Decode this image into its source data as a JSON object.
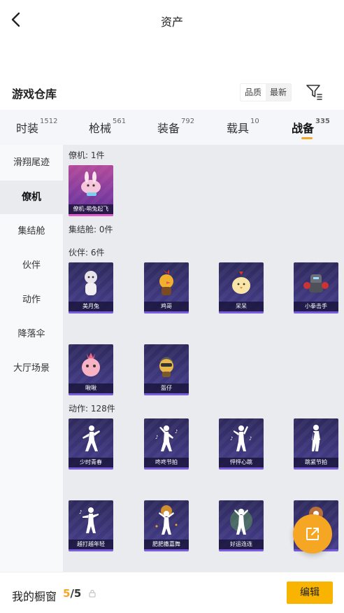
{
  "header": {
    "title": "资产",
    "back_icon": "chevron-left-icon"
  },
  "repo": {
    "title": "游戏仓库",
    "sort_options": [
      "品质",
      "最新"
    ],
    "sort_selected": "最新",
    "filter_icon": "filter-icon"
  },
  "tabs": [
    {
      "label": "时装",
      "count": "1512"
    },
    {
      "label": "枪械",
      "count": "561"
    },
    {
      "label": "装备",
      "count": "792"
    },
    {
      "label": "载具",
      "count": "10"
    },
    {
      "label": "战备",
      "count": "335",
      "active": true
    }
  ],
  "sidebar": [
    {
      "label": "滑翔尾迹"
    },
    {
      "label": "僚机",
      "active": true
    },
    {
      "label": "集结舱"
    },
    {
      "label": "伙伴"
    },
    {
      "label": "动作"
    },
    {
      "label": "降落伞"
    },
    {
      "label": "大厅场景"
    }
  ],
  "sections": {
    "wingman": {
      "label": "僚机: 1件",
      "items": [
        "僚机-萌兔起飞"
      ]
    },
    "pod": {
      "label": "集结舱: 0件"
    },
    "partner": {
      "label": "伙伴: 6件",
      "items": [
        "美月兔",
        "鸡哥",
        "呆呆",
        "小拳击手",
        "啾啾",
        "盔仔"
      ]
    },
    "action": {
      "label": "动作: 128件",
      "items": [
        "少时青春",
        "咚咚节拍",
        "怦怦心跳",
        "跳紧节拍",
        "越打越年轻",
        "肥肥撒嘉舞",
        "好运连连"
      ]
    }
  },
  "share_icon": "share-external-icon",
  "showcase": {
    "label": "我的橱窗",
    "current": "5",
    "total": "5",
    "lock_icon": "lock-icon",
    "edit_label": "编辑"
  },
  "colors": {
    "accent": "#f5a623",
    "edit_button": "#f8b400",
    "card_bg": "#3b3578"
  }
}
